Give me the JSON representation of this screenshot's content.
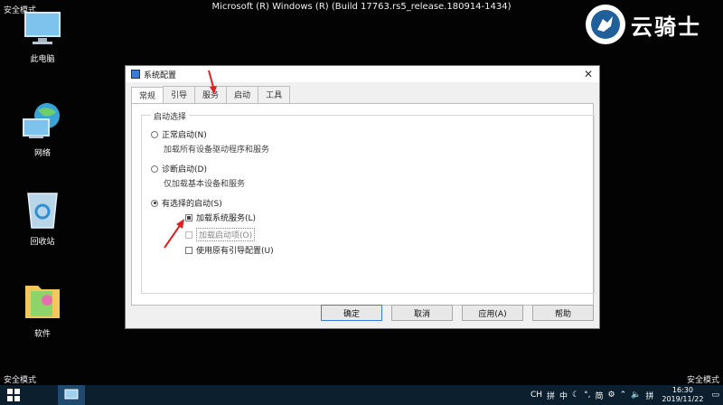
{
  "desktop": {
    "safe_mode": "安全模式",
    "build": "Microsoft (R) Windows (R) (Build 17763.rs5_release.180914-1434)",
    "brand": "云骑士",
    "icons": [
      {
        "label": "此电脑"
      },
      {
        "label": "网络"
      },
      {
        "label": "回收站"
      },
      {
        "label": "软件"
      }
    ]
  },
  "dialog": {
    "title": "系统配置",
    "tabs": [
      "常规",
      "引导",
      "服务",
      "启动",
      "工具"
    ],
    "active_tab": "常规",
    "group_title": "启动选择",
    "options": [
      {
        "label": "正常启动(N)",
        "desc": "加载所有设备驱动程序和服务",
        "selected": false
      },
      {
        "label": "诊断启动(D)",
        "desc": "仅加载基本设备和服务",
        "selected": false
      },
      {
        "label": "有选择的启动(S)",
        "selected": true
      }
    ],
    "checks": [
      {
        "label": "加载系统服务(L)",
        "state": "indeterminate"
      },
      {
        "label": "加载启动项(O)",
        "state": "disabled"
      },
      {
        "label": "使用原有引导配置(U)",
        "state": "unchecked"
      }
    ],
    "buttons": {
      "ok": "确定",
      "cancel": "取消",
      "apply": "应用(A)",
      "help": "帮助"
    }
  },
  "taskbar": {
    "tray": [
      "CH",
      "拼",
      "中",
      "简",
      "拼"
    ],
    "time": "16:30",
    "date": "2019/11/22"
  },
  "colors": {
    "annotation_arrow": "#e02020",
    "accent": "#3a7bd5"
  }
}
